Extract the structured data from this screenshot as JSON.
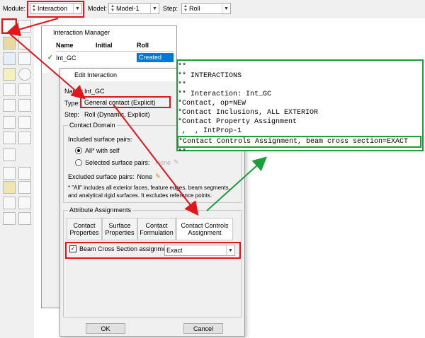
{
  "toolbar": {
    "module_label": "Module:",
    "module_value": "Interaction",
    "model_label": "Model:",
    "model_value": "Model-1",
    "step_label": "Step:",
    "step_value": "Roll"
  },
  "interaction_manager": {
    "title": "Interaction Manager",
    "columns": [
      "Name",
      "Initial",
      "Roll"
    ],
    "row": {
      "check": "✓",
      "name": "Int_GC",
      "initial": "",
      "roll": "Created"
    }
  },
  "edit_interaction": {
    "title": "Edit Interaction",
    "name_label": "Name:",
    "name_value": "Int_GC",
    "type_label": "Type:",
    "type_value": "General contact (Explicit)",
    "step_label": "Step:",
    "step_value": "Roll (Dynamic, Explicit)",
    "contact_domain_title": "Contact Domain",
    "included_label": "Included surface pairs:",
    "all_with_self": "All* with self",
    "selected_pairs": "Selected surface pairs:",
    "none_faded": "None",
    "excluded_label": "Excluded surface pairs:",
    "excluded_value": "None",
    "note": "* \"All\" includes all exterior faces, feature edges, beam segments, and analytical rigid surfaces. It excludes reference points.",
    "attr_title": "Attribute Assignments",
    "tabs": [
      {
        "line1": "Contact",
        "line2": "Properties"
      },
      {
        "line1": "Surface",
        "line2": "Properties"
      },
      {
        "line1": "Contact",
        "line2": "Formulation"
      },
      {
        "line1": "Contact Controls",
        "line2": "Assignment"
      }
    ],
    "beam_checkbox_label": "Beam Cross Section assignment:",
    "beam_value": "Exact",
    "ok": "OK",
    "cancel": "Cancel"
  },
  "keywords": [
    "**",
    "** INTERACTIONS",
    "**",
    "** Interaction: Int_GC",
    "*Contact, op=NEW",
    "*Contact Inclusions, ALL EXTERIOR",
    "*Contact Property Assignment",
    " ,  , IntProp-1",
    "*Contact Controls Assignment, beam cross section=EXACT",
    "**"
  ],
  "colors": {
    "highlight_red": "#e0161b",
    "highlight_green": "#1c9e3a",
    "selection_blue": "#0078d7"
  }
}
